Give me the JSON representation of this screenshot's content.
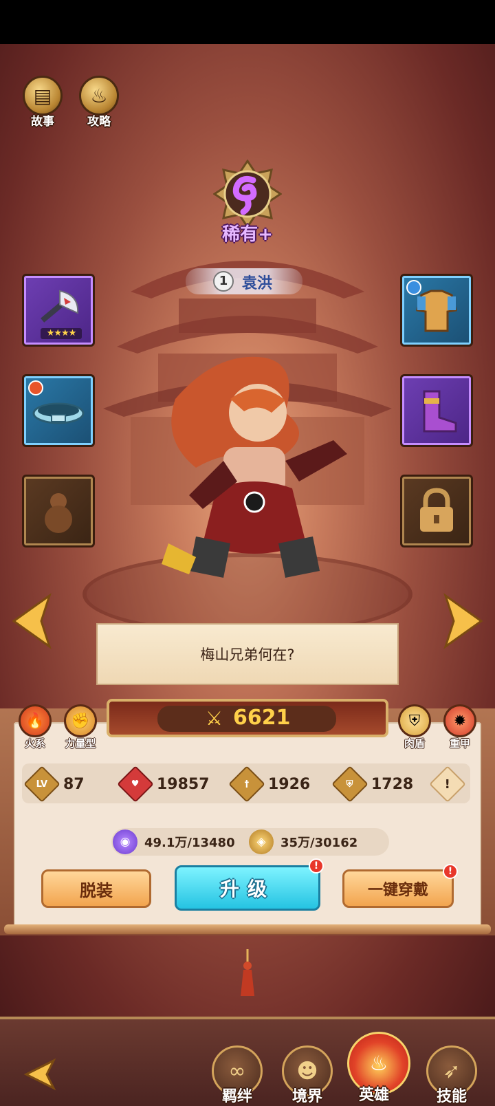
{
  "top_buttons": [
    {
      "label": "故事",
      "icon": "book-icon"
    },
    {
      "label": "攻略",
      "icon": "flame-icon"
    }
  ],
  "hero": {
    "rarity": "稀有+",
    "name": "袁洪",
    "star_level": "1",
    "dialogue": "梅山兄弟何在?"
  },
  "equipment": {
    "left": [
      {
        "name": "weapon-axe",
        "color": "#6e3fb3",
        "stars": "★★★★"
      },
      {
        "name": "belt",
        "color": "#2a79a8"
      },
      {
        "name": "gourd",
        "color": "#5b3a22"
      }
    ],
    "right": [
      {
        "name": "armor",
        "color": "#2a79a8"
      },
      {
        "name": "boots",
        "color": "#6e3fb3"
      },
      {
        "name": "locked-slot",
        "color": "#5b3a22"
      }
    ]
  },
  "power": {
    "value": "6621"
  },
  "tags": {
    "element": "火系",
    "type": "力量型",
    "role": "肉盾",
    "armor": "重甲"
  },
  "stats": {
    "level_icon": "LV",
    "level": "87",
    "hp": "19857",
    "attack": "1926",
    "defense": "1728",
    "info_icon": "!"
  },
  "resources": {
    "exp": "49.1万/13480",
    "gold": "35万/30162"
  },
  "buttons": {
    "unequip": "脱装",
    "upgrade": "升级",
    "equip_all": "一键穿戴",
    "alert": "!"
  },
  "bottom_nav": [
    {
      "label": "羁绊",
      "active": false
    },
    {
      "label": "境界",
      "active": false
    },
    {
      "label": "英雄",
      "active": true
    },
    {
      "label": "技能",
      "active": false
    }
  ],
  "colors": {
    "accent_gold": "#ffd04a",
    "upgrade_cyan": "#25c3e2",
    "alert_red": "#e8372a"
  }
}
